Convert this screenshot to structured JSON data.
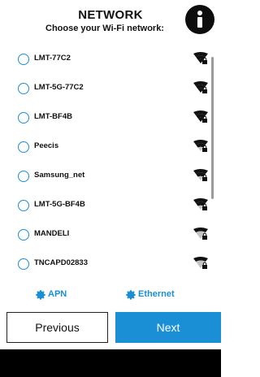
{
  "header": {
    "title": "NETWORK",
    "subtitle": "Choose your Wi-Fi network:",
    "info_icon": "info-icon"
  },
  "networks": [
    {
      "ssid": "LMT-77C2",
      "signal": "strong",
      "secured": true,
      "selected": false
    },
    {
      "ssid": "LMT-5G-77C2",
      "signal": "strong",
      "secured": true,
      "selected": false
    },
    {
      "ssid": "LMT-BF4B",
      "signal": "strong",
      "secured": true,
      "selected": false
    },
    {
      "ssid": "Peecis",
      "signal": "medium",
      "secured": true,
      "selected": false
    },
    {
      "ssid": "Samsung_net",
      "signal": "medium",
      "secured": true,
      "selected": false
    },
    {
      "ssid": "LMT-5G-BF4B",
      "signal": "medium",
      "secured": true,
      "selected": false
    },
    {
      "ssid": "MANDELI",
      "signal": "weak",
      "secured": true,
      "selected": false
    },
    {
      "ssid": "TNCAPD02833",
      "signal": "weak",
      "secured": true,
      "selected": false
    }
  ],
  "links": {
    "apn": "APN",
    "ethernet": "Ethernet"
  },
  "buttons": {
    "previous": "Previous",
    "next": "Next"
  },
  "colors": {
    "accent": "#1a8fd6",
    "text": "#111111",
    "bottom_bar": "#000000"
  }
}
